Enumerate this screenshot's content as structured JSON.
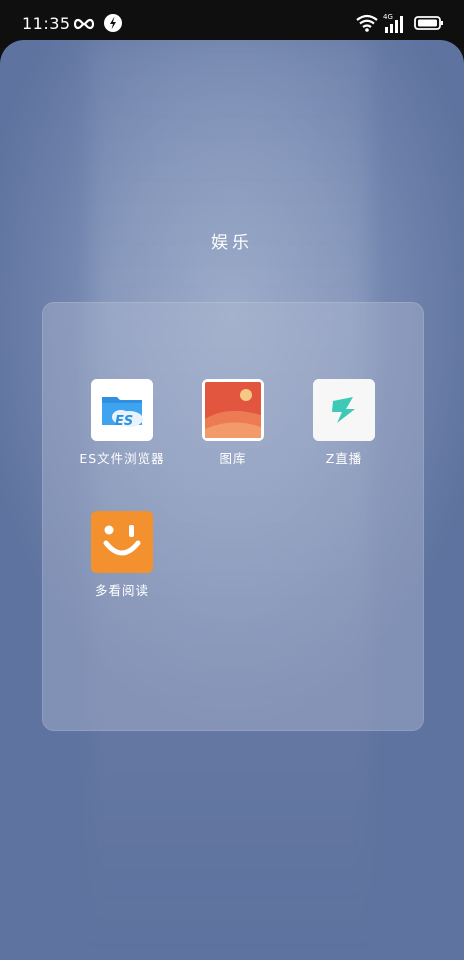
{
  "status_bar": {
    "time": "11:35",
    "network_label": "4G",
    "icons": [
      "infinity-icon",
      "navigation-icon",
      "wifi-icon",
      "signal-icon",
      "battery-icon"
    ]
  },
  "folder": {
    "title": "娱乐",
    "apps": [
      {
        "label": "ES文件浏览器",
        "icon": "es-file-explorer-icon"
      },
      {
        "label": "图库",
        "icon": "gallery-icon"
      },
      {
        "label": "Z直播",
        "icon": "z-live-icon"
      },
      {
        "label": "多看阅读",
        "icon": "duokan-reading-icon"
      }
    ]
  },
  "colors": {
    "status_bar_bg": "#0f0f0f",
    "wallpaper": "#7d90b7",
    "folder_panel": "#b0bad2",
    "duokan_orange": "#f2912d",
    "gallery_red": "#e2553f",
    "z_live_teal": "#3ec9b6",
    "es_blue": "#2f8fe0"
  }
}
